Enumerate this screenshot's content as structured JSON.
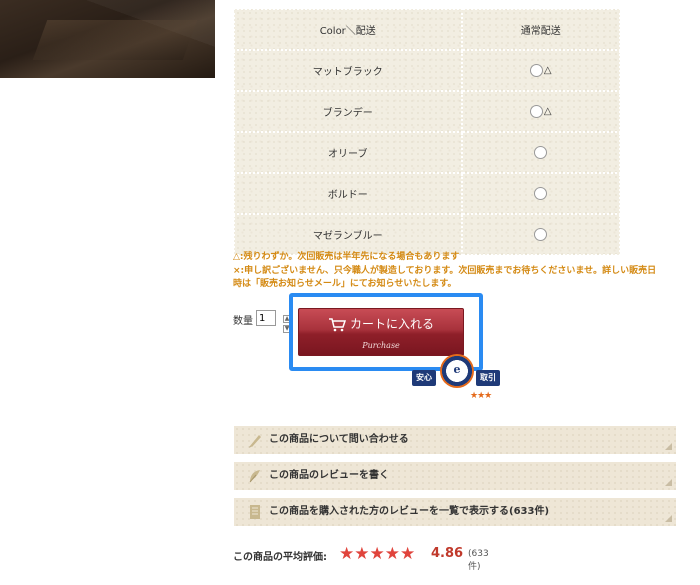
{
  "colors": {
    "accent_button": "#a8323c",
    "highlight": "#2a8bf2",
    "notice_text": "#d48a14",
    "star": "#e0443c"
  },
  "table": {
    "header": {
      "name": "Color＼配送",
      "ship": "通常配送"
    },
    "rows": [
      {
        "name": "マットブラック",
        "mark": "△",
        "status": "few-left"
      },
      {
        "name": "ブランデー",
        "mark": "△",
        "status": "few-left"
      },
      {
        "name": "オリーブ",
        "mark": "",
        "status": "available"
      },
      {
        "name": "ボルドー",
        "mark": "",
        "status": "available"
      },
      {
        "name": "マゼランブルー",
        "mark": "",
        "status": "available"
      }
    ]
  },
  "notes": {
    "line1": "△:残りわずか。次回販売は半年先になる場合もあります",
    "line2": "×:申し訳ございません、只今職人が製造しております。次回販売までお待ちくださいませ。詳しい販売日",
    "line3": "時は「販売お知らせメール」にてお知らせいたします。"
  },
  "purchase": {
    "qty_label": "数量",
    "qty_value": "1",
    "cart_label": "カートに入れる",
    "cart_sub": "Purchase",
    "cart_icon": "shopping-cart-icon"
  },
  "seal": {
    "left": "安心",
    "right": "取引",
    "center": "e",
    "stars": "★★★"
  },
  "actions": [
    {
      "label": "この商品について問い合わせる",
      "icon": "pen-icon"
    },
    {
      "label": "この商品のレビューを書く",
      "icon": "feather-icon"
    },
    {
      "label": "この商品を購入された方のレビューを一覧で表示する(633件)",
      "icon": "document-icon"
    }
  ],
  "rating": {
    "label": "この商品の平均評価:",
    "stars_value": 5,
    "stars": "★★★★★",
    "score": "4.86",
    "count": "(633件)"
  }
}
